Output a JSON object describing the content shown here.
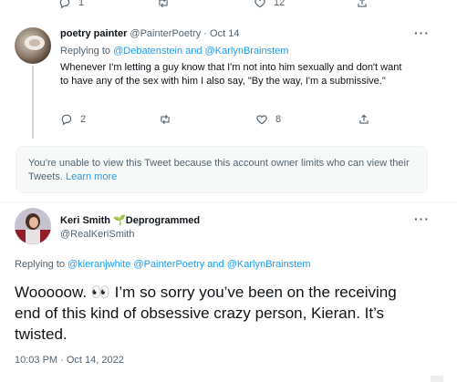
{
  "top_actions": {
    "reply_count": "1",
    "retweet_count": "",
    "like_count": "12"
  },
  "tweet1": {
    "author_name": "poetry painter",
    "author_handle": "@PainterPoetry",
    "separator": "·",
    "date": "Oct 14",
    "replying_prefix": "Replying to",
    "replying_user1": "@Debatenstein",
    "replying_and": "and",
    "replying_user2": "@KarlynBrainstem",
    "text": "Whenever I'm letting a guy know that I'm not into him sexually and don't want to have any of the sex with him I also say, \"By the way, I'm a submissive.\"",
    "reply_count": "2",
    "retweet_count": "",
    "like_count": "8"
  },
  "notice": {
    "text": "You’re unable to view this Tweet because this account owner limits who can view their Tweets.",
    "learn_more": "Learn more"
  },
  "tweet2": {
    "author_name": "Keri Smith",
    "badge_emoji": "🌱",
    "badge_text": "Deprogrammed",
    "author_handle": "@RealKeriSmith",
    "replying_prefix": "Replying to",
    "replying_user1": "@kieranjwhite",
    "replying_user2": "@PainterPoetry",
    "replying_and": "and",
    "replying_user3": "@KarlynBrainstem",
    "text": "Wooooow. 👀 I’m so sorry you’ve been on the receiving end of this kind of obsessive crazy person, Kieran. It’s twisted.",
    "timestamp": "10:03 PM · Oct 14, 2022"
  },
  "icons": {
    "reply": "reply-icon",
    "retweet": "retweet-icon",
    "like": "heart-icon",
    "share": "share-icon",
    "more": "more-icon",
    "eyes": "eyes-icon",
    "seedling": "seedling-icon"
  },
  "colors": {
    "link": "#1d9bf0",
    "muted": "#536471",
    "border": "#eff3f4",
    "notice_bg": "#f7f9f9"
  }
}
